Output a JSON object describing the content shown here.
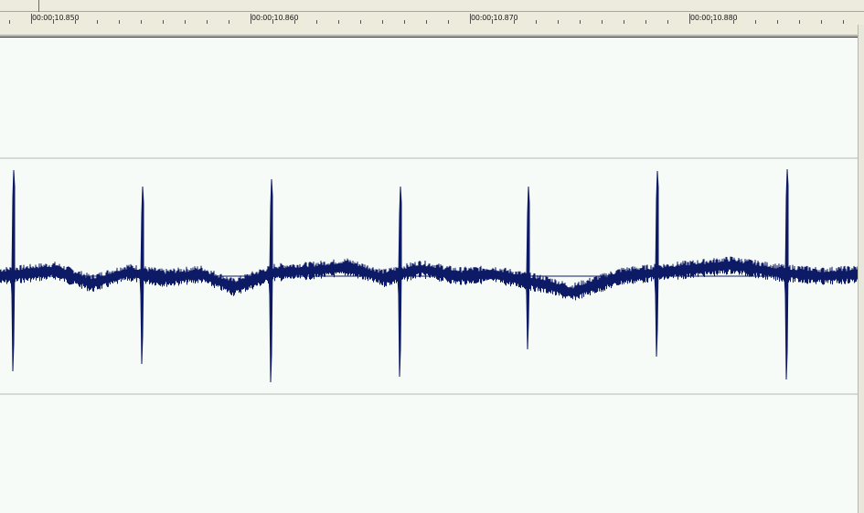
{
  "timeline": {
    "ruler_labels": [
      "00:00:10.850",
      "00:00:10.860",
      "00:00:10.870",
      "00:00:10.880"
    ]
  },
  "colors": {
    "waveform": "#0d1a66",
    "background": "#f7fbf8",
    "ruler_background": "#ecebdc",
    "guide_line": "#b5b8b3"
  },
  "waveform": {
    "spike_count": 7
  }
}
